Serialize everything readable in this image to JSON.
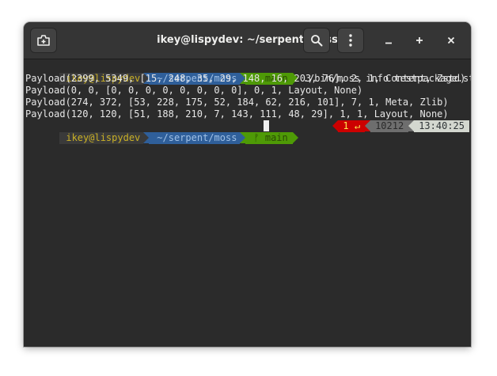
{
  "window": {
    "title": "ikey@lispydev: ~/serpent/moss"
  },
  "headerbar": {
    "new_tab_icon": "new-tab-icon",
    "search_icon": "search-icon",
    "menu_icon": "kebab-menu-icon",
    "minimize_icon": "minimize-icon",
    "maximize_icon": "maximize-icon",
    "close_icon": "close-icon"
  },
  "prompt": {
    "host": "ikey@lispydev",
    "path": "~/serpent/moss",
    "git_branch": "ᚠ main"
  },
  "command": "./bin/moss info testpackage.stone",
  "output": [
    "Payload(2399, 5349, [15, 248, 35, 29, 148, 16, 203, 76], 2, 1, Content, Zstd)",
    "Payload(0, 0, [0, 0, 0, 0, 0, 0, 0, 0], 0, 1, Layout, None)",
    "Payload(274, 372, [53, 228, 175, 52, 184, 62, 216, 101], 7, 1, Meta, Zlib)",
    "Payload(120, 120, [51, 188, 210, 7, 143, 111, 48, 29], 1, 1, Layout, None)"
  ],
  "right_prompt": {
    "status": "1 ↵",
    "history": "10212",
    "time": "13:40:25"
  },
  "colors": {
    "terminal_bg": "#2b2b2b",
    "host_fg": "#c9b026",
    "path_bg": "#2f5f9a",
    "git_bg": "#4e9a06",
    "status_bg": "#cc0000",
    "time_bg": "#d3d7cf"
  }
}
